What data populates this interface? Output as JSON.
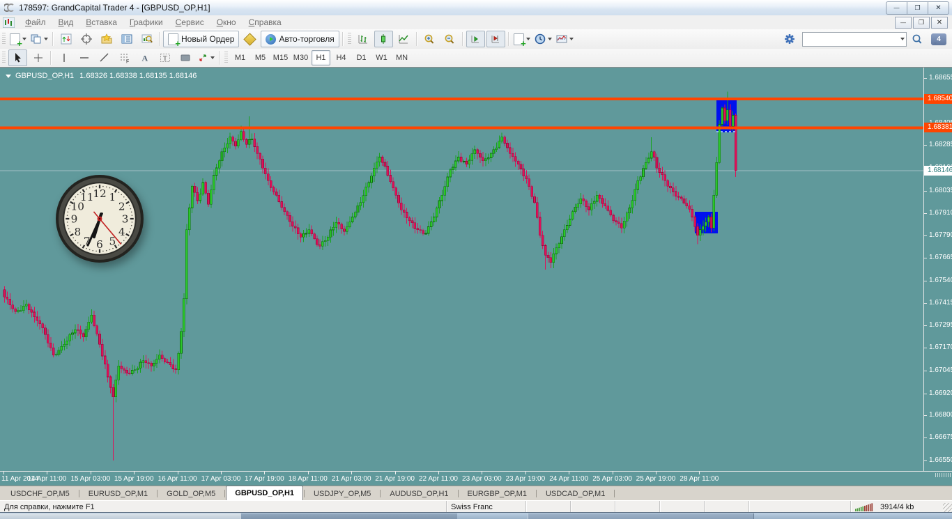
{
  "window": {
    "title": "178597: GrandCapital Trader 4 - [GBPUSD_OP,H1]"
  },
  "menu": {
    "items": [
      "Файл",
      "Вид",
      "Вставка",
      "Графики",
      "Сервис",
      "Окно",
      "Справка"
    ]
  },
  "toolbar": {
    "new_order_label": "Новый Ордер",
    "autotrading_label": "Авто-торговля",
    "search_value": "",
    "notify_count": "4",
    "timeframes": [
      "M1",
      "M5",
      "M15",
      "M30",
      "H1",
      "H4",
      "D1",
      "W1",
      "MN"
    ],
    "active_timeframe": "H1"
  },
  "chart": {
    "symbol_label": "GBPUSD_OP,H1",
    "ohlc_text": "1.68326 1.68338 1.68135 1.68146"
  },
  "chart_data": {
    "type": "candlestick",
    "symbol": "GBPUSD_OP",
    "timeframe": "H1",
    "ohlc": {
      "open": "1.68326",
      "high": "1.68338",
      "low": "1.68135",
      "close": "1.68146"
    },
    "y_axis": {
      "min": 1.6655,
      "max": 1.68655,
      "ticks": [
        "1.68655",
        "1.68530",
        "1.68405",
        "1.68285",
        "1.68160",
        "1.68035",
        "1.67910",
        "1.67790",
        "1.67665",
        "1.67540",
        "1.67415",
        "1.67295",
        "1.67170",
        "1.67045",
        "1.66920",
        "1.66800",
        "1.66675",
        "1.66550"
      ]
    },
    "x_ticks": [
      "11 Apr 2014",
      "14 Apr 11:00",
      "15 Apr 03:00",
      "15 Apr 19:00",
      "16 Apr 11:00",
      "17 Apr 03:00",
      "17 Apr 19:00",
      "18 Apr 11:00",
      "21 Apr 03:00",
      "21 Apr 19:00",
      "22 Apr 11:00",
      "23 Apr 03:00",
      "23 Apr 19:00",
      "24 Apr 11:00",
      "25 Apr 03:00",
      "25 Apr 19:00",
      "28 Apr 11:00"
    ],
    "bars_per_xtick": 16,
    "n_candles": 270,
    "close_anchors": [
      [
        0,
        1.6745
      ],
      [
        4,
        1.6737
      ],
      [
        8,
        1.6741
      ],
      [
        11,
        1.6734
      ],
      [
        14,
        1.6728
      ],
      [
        18,
        1.6713
      ],
      [
        22,
        1.6719
      ],
      [
        26,
        1.6727
      ],
      [
        29,
        1.6723
      ],
      [
        32,
        1.6735
      ],
      [
        35,
        1.6719
      ],
      [
        38,
        1.6701
      ],
      [
        40,
        1.669
      ],
      [
        42,
        1.6707
      ],
      [
        45,
        1.6703
      ],
      [
        48,
        1.6705
      ],
      [
        51,
        1.671
      ],
      [
        54,
        1.6707
      ],
      [
        57,
        1.6713
      ],
      [
        60,
        1.6709
      ],
      [
        63,
        1.6705
      ],
      [
        64,
        1.6714
      ],
      [
        65,
        1.6726
      ],
      [
        66,
        1.6744
      ],
      [
        67,
        1.6782
      ],
      [
        69,
        1.6806
      ],
      [
        71,
        1.6798
      ],
      [
        73,
        1.6808
      ],
      [
        75,
        1.6796
      ],
      [
        77,
        1.6812
      ],
      [
        79,
        1.682
      ],
      [
        81,
        1.6827
      ],
      [
        83,
        1.6833
      ],
      [
        85,
        1.6828
      ],
      [
        87,
        1.6836
      ],
      [
        89,
        1.6829
      ],
      [
        91,
        1.6832
      ],
      [
        93,
        1.6824
      ],
      [
        95,
        1.6816
      ],
      [
        97,
        1.6809
      ],
      [
        100,
        1.6801
      ],
      [
        103,
        1.6792
      ],
      [
        106,
        1.6784
      ],
      [
        109,
        1.6778
      ],
      [
        112,
        1.6782
      ],
      [
        114,
        1.6777
      ],
      [
        116,
        1.6773
      ],
      [
        119,
        1.6778
      ],
      [
        122,
        1.6786
      ],
      [
        125,
        1.6781
      ],
      [
        128,
        1.6789
      ],
      [
        131,
        1.6797
      ],
      [
        134,
        1.6808
      ],
      [
        136,
        1.6816
      ],
      [
        138,
        1.6822
      ],
      [
        140,
        1.6817
      ],
      [
        143,
        1.6805
      ],
      [
        146,
        1.6793
      ],
      [
        149,
        1.6787
      ],
      [
        152,
        1.6782
      ],
      [
        155,
        1.678
      ],
      [
        158,
        1.6789
      ],
      [
        161,
        1.6801
      ],
      [
        164,
        1.6815
      ],
      [
        167,
        1.6822
      ],
      [
        170,
        1.6818
      ],
      [
        173,
        1.6826
      ],
      [
        176,
        1.682
      ],
      [
        179,
        1.6824
      ],
      [
        183,
        1.6833
      ],
      [
        186,
        1.6824
      ],
      [
        189,
        1.6818
      ],
      [
        192,
        1.681
      ],
      [
        195,
        1.6797
      ],
      [
        197,
        1.6779
      ],
      [
        199,
        1.6768
      ],
      [
        201,
        1.6764
      ],
      [
        203,
        1.6772
      ],
      [
        206,
        1.6782
      ],
      [
        209,
        1.6792
      ],
      [
        212,
        1.6799
      ],
      [
        215,
        1.6793
      ],
      [
        218,
        1.6801
      ],
      [
        221,
        1.6795
      ],
      [
        224,
        1.6787
      ],
      [
        227,
        1.6783
      ],
      [
        230,
        1.6794
      ],
      [
        233,
        1.6809
      ],
      [
        236,
        1.6819
      ],
      [
        238,
        1.6825
      ],
      [
        240,
        1.6816
      ],
      [
        243,
        1.6809
      ],
      [
        246,
        1.6803
      ],
      [
        249,
        1.6799
      ],
      [
        251,
        1.6795
      ],
      [
        253,
        1.6789
      ],
      [
        255,
        1.6779
      ],
      [
        257,
        1.6784
      ],
      [
        259,
        1.6789
      ],
      [
        260,
        1.6783
      ],
      [
        261,
        1.6801
      ],
      [
        262,
        1.6819
      ],
      [
        263,
        1.684
      ],
      [
        264,
        1.6849
      ],
      [
        265,
        1.6842
      ],
      [
        266,
        1.6848
      ],
      [
        267,
        1.6839
      ],
      [
        268,
        1.6845
      ],
      [
        269,
        1.68146
      ]
    ],
    "spikes": [
      {
        "i": 40,
        "low": 1.6655
      },
      {
        "i": 90,
        "high": 1.68445
      },
      {
        "i": 199,
        "low": 1.676
      },
      {
        "i": 238,
        "high": 1.6833
      },
      {
        "i": 255,
        "low": 1.6774
      },
      {
        "i": 266,
        "high": 1.6858
      },
      {
        "i": 269,
        "low": 1.6811
      }
    ],
    "h_lines": [
      {
        "price": 1.6854,
        "label": "1.68540",
        "color": "#FF4500"
      },
      {
        "price": 1.68381,
        "label": "1.68381",
        "color": "#FF4500"
      }
    ],
    "bid": {
      "price": 1.68146,
      "label": "1.68146"
    },
    "highlight_boxes": [
      {
        "i0": 262.3,
        "i1": 269.7,
        "price_top": 1.68544,
        "price_bottom": 1.68356
      },
      {
        "i0": 254.4,
        "i1": 262.8,
        "price_top": 1.67918,
        "price_bottom": 1.678
      }
    ],
    "colors": {
      "background": "#60999B",
      "bull_fill": "#2BC62B",
      "bull_stroke": "#0B6F0B",
      "bull_wick": "#17A31F",
      "bear_fill": "#DE1159",
      "bear_stroke": "#9B0A3E",
      "bear_wick": "#DE1159",
      "hline": "#FF4500",
      "box": "#0011EE",
      "bid_line": "#D8DEE8",
      "axis_text": "#FFFFFF"
    }
  },
  "clock": {
    "time": "06:34:23",
    "hour_angle": 197,
    "minute_angle": 204,
    "second_angle": 140
  },
  "tabs": {
    "items": [
      "USDCHF_OP,M5",
      "EURUSD_OP,M1",
      "GOLD_OP,M5",
      "GBPUSD_OP,H1",
      "USDJPY_OP,M5",
      "AUDUSD_OP,H1",
      "EURGBP_OP,M1",
      "USDCAD_OP,M1"
    ],
    "active_index": 3
  },
  "statusbar": {
    "help_text": "Для справки, нажмите F1",
    "symbol_description": "Swiss Franc",
    "traffic": "3914/4 kb"
  }
}
